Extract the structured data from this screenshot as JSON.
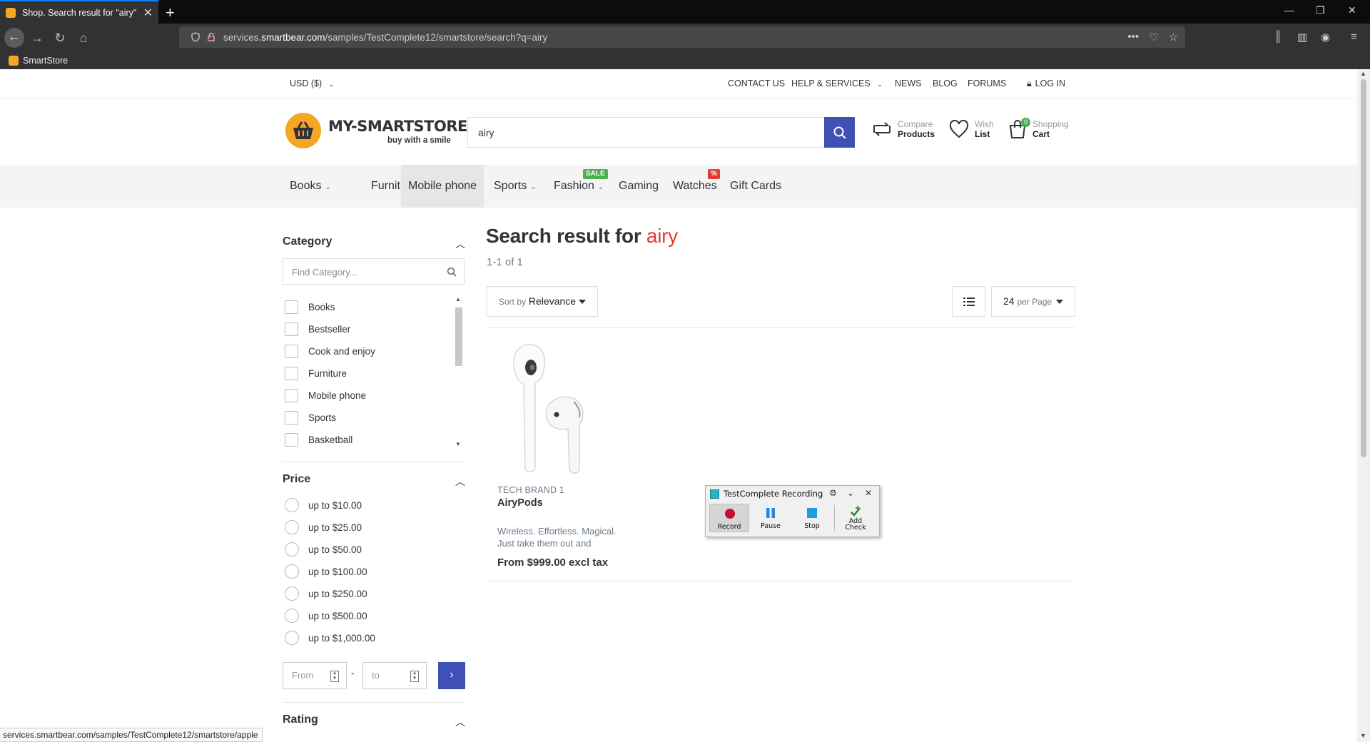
{
  "browser": {
    "tab_title": "Shop. Search result for \"airy\"",
    "url_prefix": "services.",
    "url_host": "smartbear.com",
    "url_path": "/samples/TestComplete12/smartstore/search?q=airy",
    "bookmark": "SmartStore",
    "status_url": "services.smartbear.com/samples/TestComplete12/smartstore/apple"
  },
  "topbar": {
    "currency": "USD ($)",
    "contact": "CONTACT US",
    "help": "HELP & SERVICES",
    "news": "NEWS",
    "blog": "BLOG",
    "forums": "FORUMS",
    "login": "LOG IN"
  },
  "header": {
    "logo_text": "MY-SMARTSTORE",
    "logo_tagline": "buy with a smile",
    "search_value": "airy",
    "compare_top": "Compare",
    "compare_bottom": "Products",
    "wish_top": "Wish",
    "wish_bottom": "List",
    "cart_top": "Shopping",
    "cart_bottom": "Cart",
    "cart_count": "0"
  },
  "menu": {
    "items": [
      "Books",
      "Furniture",
      "Mobile phone",
      "Sports",
      "Fashion",
      "Gaming",
      "Watches",
      "Gift Cards"
    ],
    "sale_badge": "SALE",
    "percent_badge": "%"
  },
  "sidebar": {
    "category_title": "Category",
    "category_placeholder": "Find Category...",
    "categories": [
      "Books",
      "Bestseller",
      "Cook and enjoy",
      "Furniture",
      "Mobile phone",
      "Sports",
      "Basketball"
    ],
    "price_title": "Price",
    "prices": [
      "up to $10.00",
      "up to $25.00",
      "up to $50.00",
      "up to $100.00",
      "up to $250.00",
      "up to $500.00",
      "up to $1,000.00"
    ],
    "from_placeholder": "From",
    "to_placeholder": "to",
    "rating_title": "Rating"
  },
  "results": {
    "title_prefix": "Search result for",
    "query": "airy",
    "count": "1-1 of 1",
    "sort_prefix": "Sort by",
    "sort_value": "Relevance",
    "per_page_value": "24",
    "per_page_suffix": "per Page"
  },
  "product": {
    "brand": "TECH BRAND 1",
    "name": "AiryPods",
    "description": "Wireless. Effortless. Magical. Just take them out and",
    "price": "From $999.00 excl tax"
  },
  "recorder": {
    "title": "TestComplete Recording",
    "record": "Record",
    "pause": "Pause",
    "stop": "Stop",
    "add_check_1": "Add",
    "add_check_2": "Check"
  },
  "colors": {
    "accent": "#3f51b5",
    "query_red": "#e53935",
    "sale_green": "#4caf50",
    "percent_red": "#e53935"
  }
}
